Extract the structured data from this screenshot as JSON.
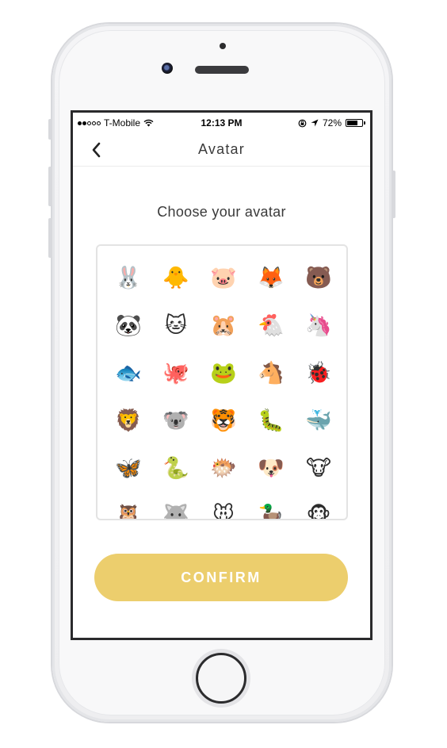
{
  "status_bar": {
    "carrier": "T-Mobile",
    "time": "12:13 PM",
    "battery": "72%",
    "battery_level": 0.72,
    "signal_bars": 2,
    "icons": [
      "wifi-icon",
      "rotation-lock-icon",
      "location-arrow-icon",
      "battery-icon"
    ]
  },
  "nav": {
    "back_icon": "chevron-left-icon",
    "title": "Avatar"
  },
  "main": {
    "prompt": "Choose your avatar",
    "avatars": [
      {
        "name": "rabbit",
        "glyph": "🐰"
      },
      {
        "name": "chick",
        "glyph": "🐥"
      },
      {
        "name": "pig",
        "glyph": "🐷"
      },
      {
        "name": "fox",
        "glyph": "🦊"
      },
      {
        "name": "bear",
        "glyph": "🐻"
      },
      {
        "name": "panda",
        "glyph": "🐼"
      },
      {
        "name": "cat",
        "glyph": "🐱"
      },
      {
        "name": "hamster",
        "glyph": "🐹"
      },
      {
        "name": "chicken",
        "glyph": "🐔"
      },
      {
        "name": "unicorn",
        "glyph": "🦄"
      },
      {
        "name": "fish",
        "glyph": "🐟"
      },
      {
        "name": "octopus",
        "glyph": "🐙"
      },
      {
        "name": "frog",
        "glyph": "🐸"
      },
      {
        "name": "horse",
        "glyph": "🐴"
      },
      {
        "name": "ladybug",
        "glyph": "🐞"
      },
      {
        "name": "lion",
        "glyph": "🦁"
      },
      {
        "name": "koala",
        "glyph": "🐨"
      },
      {
        "name": "tiger",
        "glyph": "🐯"
      },
      {
        "name": "caterpillar",
        "glyph": "🐛"
      },
      {
        "name": "whale",
        "glyph": "🐳"
      },
      {
        "name": "butterfly",
        "glyph": "🦋"
      },
      {
        "name": "snake",
        "glyph": "🐍"
      },
      {
        "name": "blowfish",
        "glyph": "🐡"
      },
      {
        "name": "dog",
        "glyph": "🐶"
      },
      {
        "name": "cow",
        "glyph": "🐮"
      },
      {
        "name": "owl",
        "glyph": "🦉"
      },
      {
        "name": "wolf",
        "glyph": "🐺"
      },
      {
        "name": "mouse",
        "glyph": "🐭"
      },
      {
        "name": "duck",
        "glyph": "🦆"
      },
      {
        "name": "monkey",
        "glyph": "🐵"
      }
    ],
    "confirm_label": "CONFIRM"
  },
  "colors": {
    "accent": "#ecce6d",
    "title_text": "#3b3b3b",
    "panel_border": "#e3e3e3"
  }
}
